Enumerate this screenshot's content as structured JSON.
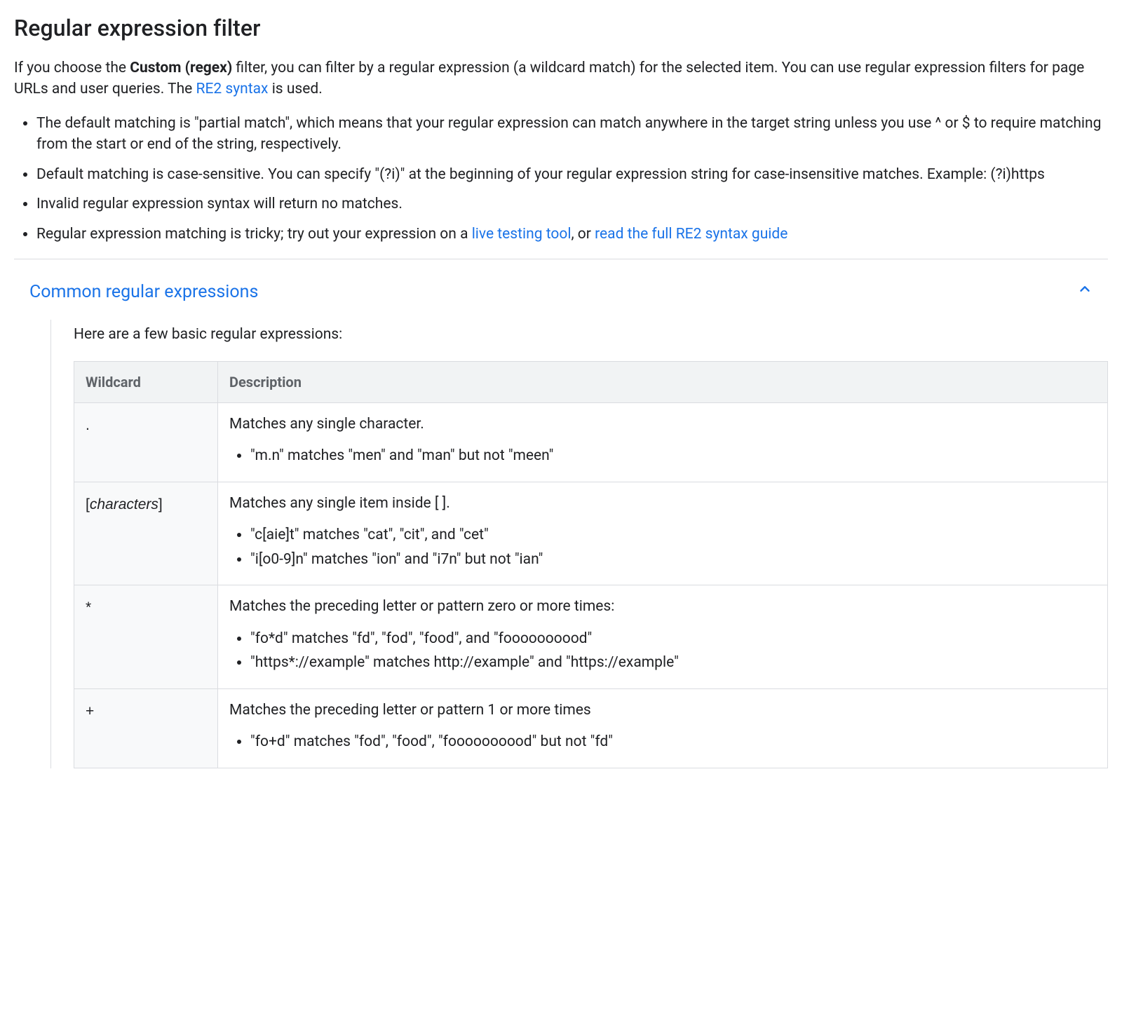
{
  "title": "Regular expression filter",
  "intro": {
    "pre_bold": "If you choose the ",
    "bold": "Custom (regex)",
    "post_bold": " filter, you can filter by a regular expression (a wildcard match) for the selected item. You can use regular expression filters for page URLs and user queries. The ",
    "link1": "RE2 syntax",
    "suffix": " is used."
  },
  "bullets": {
    "b1": "The default matching is \"partial match\", which means that your regular expression can match anywhere in the target string unless you use ^ or $ to require matching from the start or end of the string, respectively.",
    "b2": "Default matching is case-sensitive. You can specify \"(?i)\" at the beginning of your regular expression string for case-insensitive matches. Example: (?i)https",
    "b3": "Invalid regular expression syntax will return no matches.",
    "b4_pre": "Regular expression matching is tricky; try out your expression on a ",
    "b4_link1": "live testing tool",
    "b4_mid": ", or ",
    "b4_link2": "read the full RE2 syntax guide"
  },
  "accordion": {
    "title": "Common regular expressions",
    "intro": "Here are a few basic regular expressions:"
  },
  "table": {
    "headers": {
      "wildcard": "Wildcard",
      "description": "Description"
    },
    "rows": {
      "r1": {
        "wildcard": ".",
        "desc": "Matches any single character.",
        "items": {
          "i1": "\"m.n\" matches \"men\" and \"man\" but not \"meen\""
        }
      },
      "r2": {
        "wc_pre": "[",
        "wc_ital": "characters",
        "wc_post": "]",
        "desc": "Matches any single item inside [ ].",
        "items": {
          "i1": "\"c[aie]t\" matches \"cat\", \"cit\", and \"cet\"",
          "i2": "\"i[o0-9]n\" matches \"ion\" and \"i7n\" but not \"ian\""
        }
      },
      "r3": {
        "wildcard": "*",
        "desc": "Matches the preceding letter or pattern zero or more times:",
        "items": {
          "i1": "\"fo*d\" matches \"fd\", \"fod\", \"food\", and \"foooooooood\"",
          "i2": "\"https*://example\" matches http://example\" and \"https://example\""
        }
      },
      "r4": {
        "wildcard": "+",
        "desc": "Matches the preceding letter or pattern 1 or more times",
        "items": {
          "i1": "\"fo+d\" matches \"fod\", \"food\", \"foooooooood\" but not \"fd\""
        }
      }
    }
  }
}
